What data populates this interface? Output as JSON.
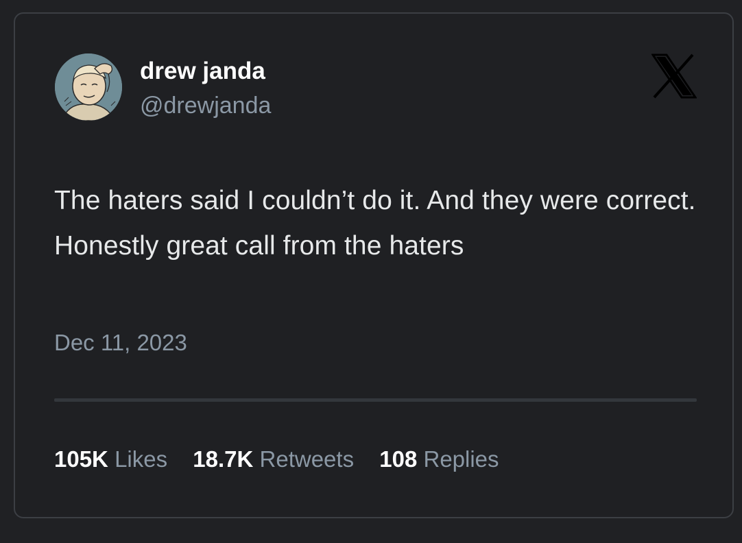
{
  "author": {
    "name": "drew janda",
    "handle": "@drewjanda",
    "avatar_icon": "cartoon-boy-avatar-icon"
  },
  "platform_logo": "x-logo-icon",
  "tweet": {
    "text": "The haters said I couldn’t do it. And they were correct. Honestly great call from the haters",
    "date": "Dec 11, 2023"
  },
  "stats": [
    {
      "value": "105K",
      "label": "Likes"
    },
    {
      "value": "18.7K",
      "label": "Retweets"
    },
    {
      "value": "108",
      "label": "Replies"
    }
  ],
  "colors": {
    "background": "#1f2023",
    "primary_text": "#e7e9ea",
    "secondary_text": "#8b98a5",
    "border": "#3c3f44"
  }
}
